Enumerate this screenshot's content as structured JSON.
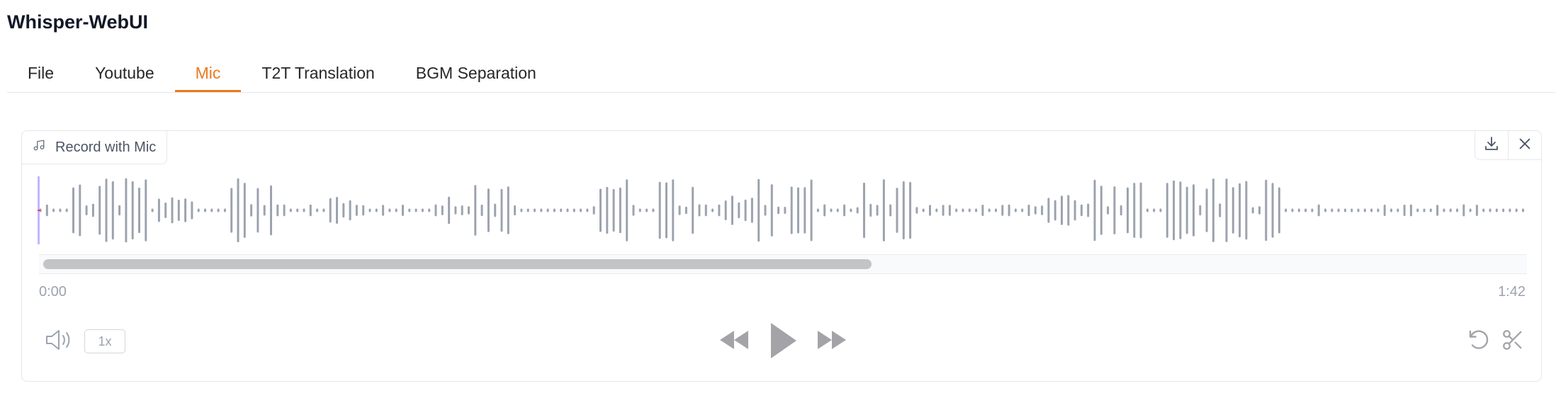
{
  "app": {
    "title": "Whisper-WebUI"
  },
  "tabs": [
    {
      "label": "File",
      "active": false
    },
    {
      "label": "Youtube",
      "active": false
    },
    {
      "label": "Mic",
      "active": true
    },
    {
      "label": "T2T Translation",
      "active": false
    },
    {
      "label": "BGM Separation",
      "active": false
    }
  ],
  "audio": {
    "label": "Record with Mic",
    "current_time": "0:00",
    "duration": "1:42",
    "speed": "1x",
    "scroll_visible_fraction": 0.56,
    "icons": {
      "label": "music-note-icon",
      "download": "download-icon",
      "clear": "close-icon",
      "volume": "volume-icon",
      "rewind": "rewind-icon",
      "play": "play-icon",
      "forward": "fast-forward-icon",
      "undo": "undo-icon",
      "trim": "scissors-icon"
    }
  },
  "colors": {
    "accent": "#ea7a1f",
    "waveform": "#9ca3af",
    "playhead": "#ef4444",
    "border": "#e5e7eb"
  }
}
